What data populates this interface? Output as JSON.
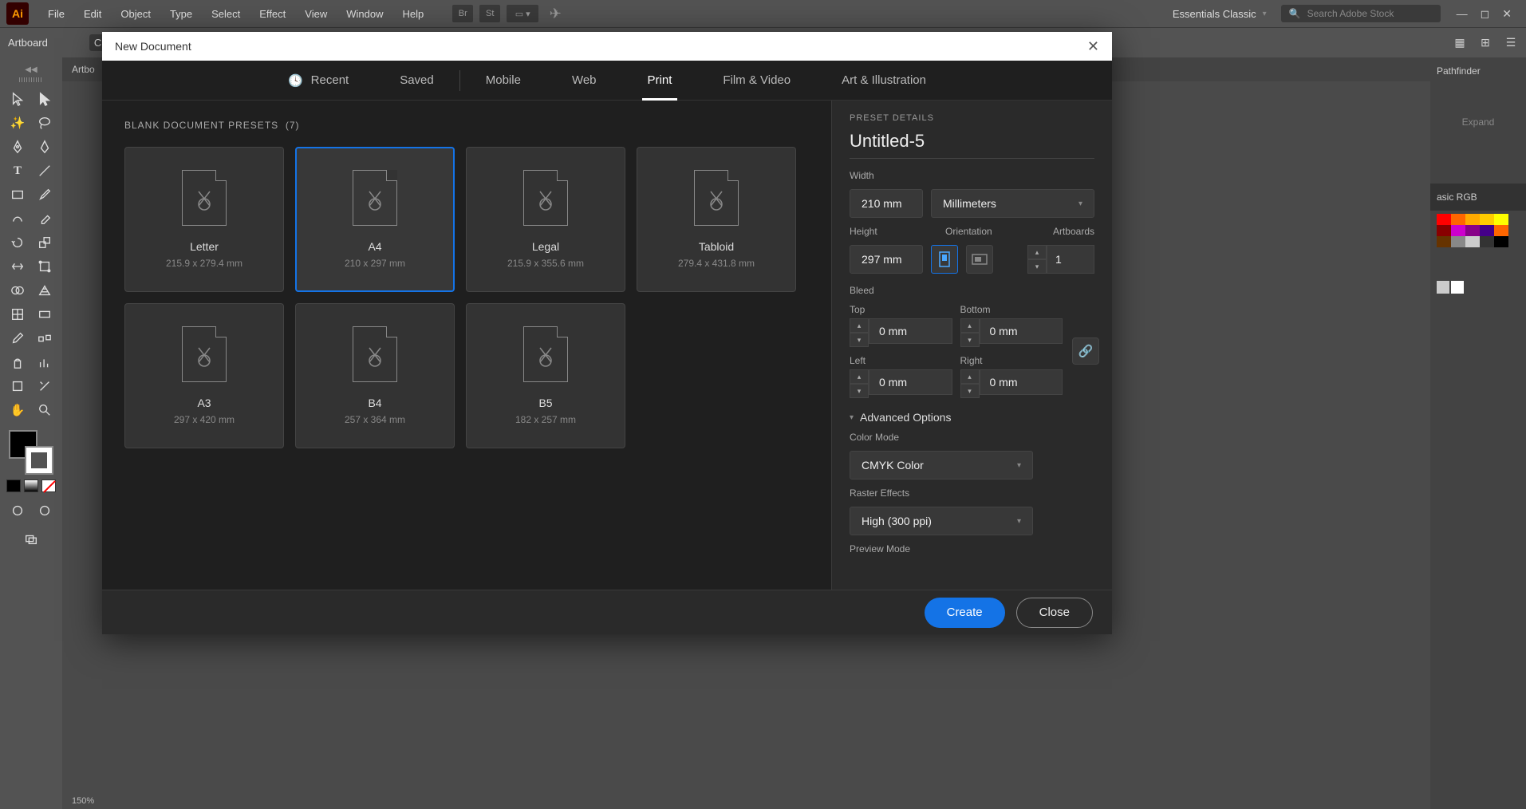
{
  "app": {
    "logo": "Ai"
  },
  "menu": [
    "File",
    "Edit",
    "Object",
    "Type",
    "Select",
    "Effect",
    "View",
    "Window",
    "Help"
  ],
  "menuIcons": {
    "br": "Br",
    "st": "St"
  },
  "workspace": "Essentials Classic",
  "searchPlaceholder": "Search Adobe Stock",
  "controlBar": {
    "label": "Artboard",
    "cutoff": "Cu"
  },
  "docTab": "Artbo",
  "statusZoom": "150%",
  "rightPanels": {
    "pathfinder": "Pathfinder",
    "expand": "Expand",
    "basicRGB": "asic RGB"
  },
  "modal": {
    "title": "New Document",
    "tabs": [
      "Recent",
      "Saved",
      "Mobile",
      "Web",
      "Print",
      "Film & Video",
      "Art & Illustration"
    ],
    "activeTab": "Print",
    "presetsHeader": "BLANK DOCUMENT PRESETS",
    "presetsCount": "(7)",
    "presets": [
      {
        "name": "Letter",
        "dim": "215.9 x 279.4 mm"
      },
      {
        "name": "A4",
        "dim": "210 x 297 mm"
      },
      {
        "name": "Legal",
        "dim": "215.9 x 355.6 mm"
      },
      {
        "name": "Tabloid",
        "dim": "279.4 x 431.8 mm"
      },
      {
        "name": "A3",
        "dim": "297 x 420 mm"
      },
      {
        "name": "B4",
        "dim": "257 x 364 mm"
      },
      {
        "name": "B5",
        "dim": "182 x 257 mm"
      }
    ],
    "details": {
      "title": "PRESET DETAILS",
      "docName": "Untitled-5",
      "widthLabel": "Width",
      "width": "210 mm",
      "units": "Millimeters",
      "heightLabel": "Height",
      "height": "297 mm",
      "orientationLabel": "Orientation",
      "artboardsLabel": "Artboards",
      "artboards": "1",
      "bleedLabel": "Bleed",
      "bleedTopLabel": "Top",
      "bleedBottomLabel": "Bottom",
      "bleedLeftLabel": "Left",
      "bleedRightLabel": "Right",
      "bleedTop": "0 mm",
      "bleedBottom": "0 mm",
      "bleedLeft": "0 mm",
      "bleedRight": "0 mm",
      "advancedLabel": "Advanced Options",
      "colorModeLabel": "Color Mode",
      "colorMode": "CMYK Color",
      "rasterLabel": "Raster Effects",
      "raster": "High (300 ppi)",
      "previewLabel": "Preview Mode"
    },
    "footer": {
      "create": "Create",
      "close": "Close"
    }
  }
}
